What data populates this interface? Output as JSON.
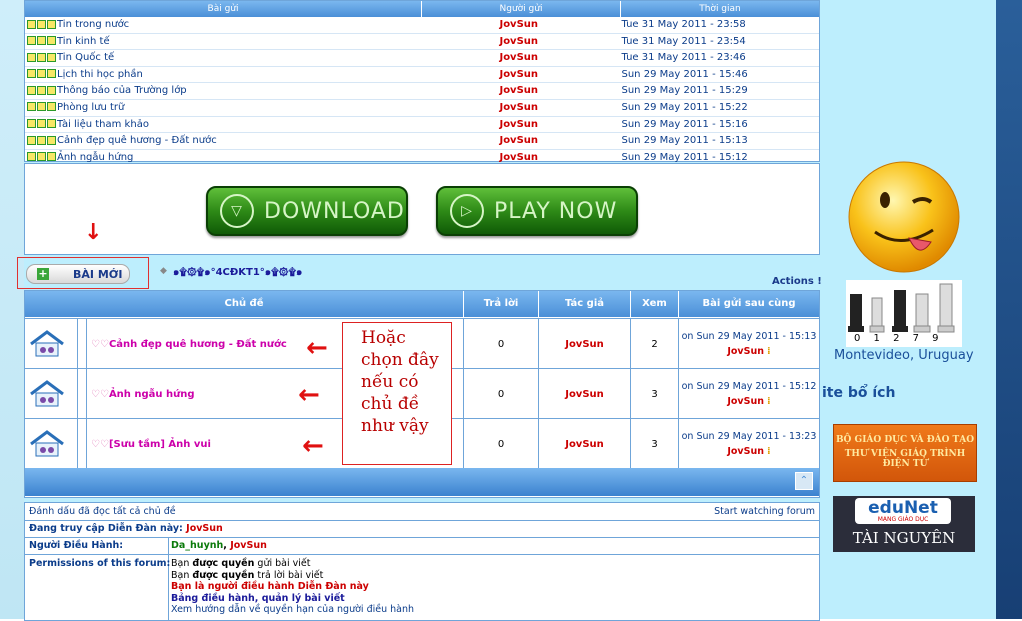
{
  "posts": {
    "headers": [
      "Bài gửi",
      "Người gửi",
      "Thời gian"
    ],
    "rows": [
      {
        "title": "Tin trong nước",
        "author": "JovSun",
        "time": "Tue 31 May 2011 - 23:58"
      },
      {
        "title": "Tin kinh tế",
        "author": "JovSun",
        "time": "Tue 31 May 2011 - 23:54"
      },
      {
        "title": "Tin Quốc tế",
        "author": "JovSun",
        "time": "Tue 31 May 2011 - 23:46"
      },
      {
        "title": "Lịch thi học phần",
        "author": "JovSun",
        "time": "Sun 29 May 2011 - 15:46"
      },
      {
        "title": "Thông báo của Trường lớp",
        "author": "JovSun",
        "time": "Sun 29 May 2011 - 15:29"
      },
      {
        "title": "Phòng lưu trữ",
        "author": "JovSun",
        "time": "Sun 29 May 2011 - 15:22"
      },
      {
        "title": "Tài liệu tham khảo",
        "author": "JovSun",
        "time": "Sun 29 May 2011 - 15:16"
      },
      {
        "title": "Cảnh đẹp quê hương - Đất nước",
        "author": "JovSun",
        "time": "Sun 29 May 2011 - 15:13"
      },
      {
        "title": "Ảnh ngẫu hứng",
        "author": "JovSun",
        "time": "Sun 29 May 2011 - 15:12"
      }
    ]
  },
  "ads": {
    "download": "DOWNLOAD",
    "play": "PLAY NOW"
  },
  "toolbar": {
    "new_topic": "BÀI MỚI",
    "forum_name": "๑۩۞۩๑°4CĐKT1°๑۩۞۩๑",
    "actions": "Actions !"
  },
  "topics": {
    "headers": [
      "Chủ đề",
      "Trả lời",
      "Tác giả",
      "Xem",
      "Bài gửi sau cùng"
    ],
    "rows": [
      {
        "title": "Cảnh đẹp quê hương - Đất nước",
        "replies": "0",
        "author": "JovSun",
        "views": "2",
        "last_time": "on Sun 29 May 2011 - 15:13",
        "last_author": "JovSun"
      },
      {
        "title": "Ảnh ngẫu hứng",
        "replies": "0",
        "author": "JovSun",
        "views": "3",
        "last_time": "on Sun 29 May 2011 - 15:12",
        "last_author": "JovSun"
      },
      {
        "title": "[Sưu tầm] Ảnh vui",
        "replies": "0",
        "author": "JovSun",
        "views": "3",
        "last_time": "on Sun 29 May 2011 - 13:23",
        "last_author": "JovSun"
      }
    ],
    "note": [
      "Hoặc",
      "chọn đây",
      "nếu có",
      "chủ đề",
      "như vậy"
    ]
  },
  "info": {
    "mark_read": "Đánh dấu đã đọc tất cả chủ đề",
    "watch": "Start watching forum",
    "browsing_label": "Đang truy cập Diễn Đàn này:",
    "browsing_user": "JovSun",
    "mods_label": "Người Điều Hành:",
    "mod1": "Da_huynh",
    "mod2": "JovSun",
    "perm_label": "Permissions of this forum:",
    "perm_lines": [
      {
        "pre": "Bạn ",
        "strong": "được quyền",
        "post": " gửi bài viết"
      },
      {
        "pre": "Bạn ",
        "strong": "được quyền",
        "post": " trả lời bài viết"
      }
    ],
    "perm_mod": "Bạn là người điều hành Diễn Đàn này",
    "perm_admin": "Bảng điều hành, quản lý bài viết",
    "perm_help": "Xem hướng dẫn về quyền hạn của người điều hành"
  },
  "sidebar": {
    "chess_digits": "0 1 2 7 9",
    "location": "Montevideo, Uruguay",
    "useful": "ite bổ ích",
    "ministry": "BỘ GIÁO DỤC VÀ ĐÀO TẠO",
    "library": "THƯ VIỆN GIÁO TRÌNH ĐIỆN TỬ",
    "edunet": "eduNet",
    "edunet_sub": "MẠNG GIÁO DỤC",
    "resource": "TÀI NGUYÊN"
  }
}
